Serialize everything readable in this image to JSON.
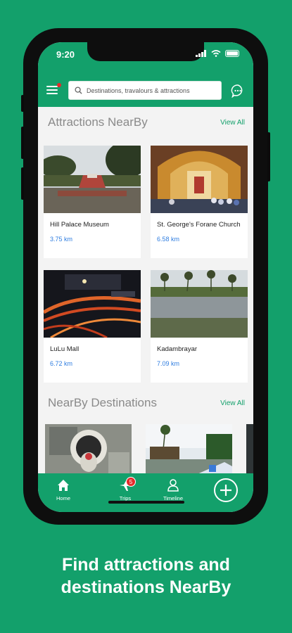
{
  "status": {
    "time": "9:20"
  },
  "search": {
    "placeholder": "Destinations, travalours & attractions"
  },
  "attractions": {
    "title": "Attractions NearBy",
    "view_all": "View All",
    "items": [
      {
        "name": "Hill Palace Museum",
        "distance": "3.75 km"
      },
      {
        "name": "St. George's Forane Church",
        "distance": "6.58 km"
      },
      {
        "name": "LuLu Mall",
        "distance": "6.72 km"
      },
      {
        "name": "Kadambrayar",
        "distance": "7.09 km"
      }
    ]
  },
  "destinations": {
    "title": "NearBy Destinations",
    "view_all": "View All"
  },
  "nav": {
    "home": "Home",
    "trips": "Trips",
    "trips_badge": "5",
    "timeline": "Timeline"
  },
  "caption": {
    "line1": "Find attractions and",
    "line2": "destinations NearBy"
  },
  "colors": {
    "brand": "#13a06b",
    "distance": "#2f7de0",
    "badge": "#e52a2a"
  }
}
